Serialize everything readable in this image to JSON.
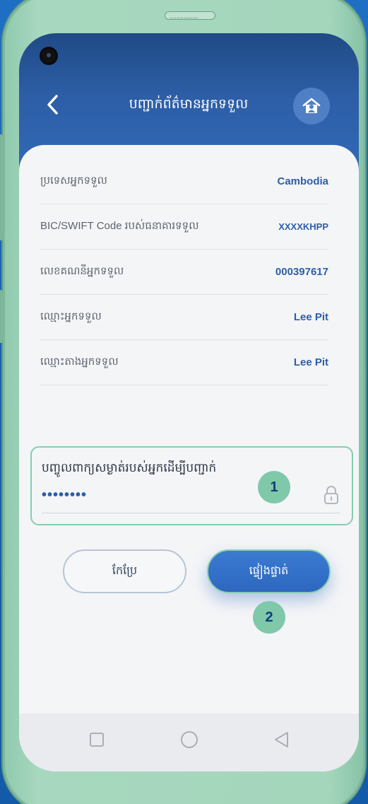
{
  "header": {
    "title": "បញ្ជាក់ព័ត៌មានអ្នកទទួល"
  },
  "details": [
    {
      "label": "ប្រទេសអ្នកទទួល",
      "value": "Cambodia"
    },
    {
      "label": "BIC/SWIFT Code របស់ធនាគារទទួល",
      "value": "XXXXKHPP"
    },
    {
      "label": "លេខគណនីអ្នកទទួល",
      "value": "000397617"
    },
    {
      "label": "ឈ្មោះអ្នកទទួល",
      "value": "Lee Pit"
    },
    {
      "label": "ឈ្មោះតាងអ្នកទទួល",
      "value": "Lee Pit"
    }
  ],
  "password": {
    "label": "បញ្ចូលពាក្យសម្ងាត់របស់អ្នកដើម្បីបញ្ជាក់",
    "value": "••••••••"
  },
  "buttons": {
    "edit": "កែប្រែ",
    "verify": "ផ្ទៀងផ្ទាត់"
  },
  "badges": {
    "first": "1",
    "second": "2"
  },
  "speaker_text": "................",
  "icons": {
    "back": "chevron-left-icon",
    "home": "home-user-icon",
    "lock": "lock-icon",
    "nav_recent": "square-icon",
    "nav_home": "circle-icon",
    "nav_back": "triangle-back-icon"
  },
  "colors": {
    "primary": "#2d5ea7",
    "accent_green": "#85cdb0"
  }
}
